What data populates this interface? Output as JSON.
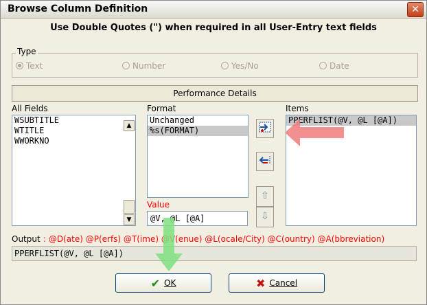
{
  "window": {
    "title": "Browse Column Definition",
    "close": "✕"
  },
  "banner": "Use Double Quotes (\") when required in all User-Entry text fields",
  "type_group": {
    "label": "Type",
    "options": [
      "Text",
      "Number",
      "Yes/No",
      "Date"
    ],
    "selected": "Text"
  },
  "perf_bar": "Performance Details",
  "all_fields": {
    "label": "All Fields",
    "items": [
      "WSUBTITLE",
      "WTITLE",
      "WWORKNO"
    ]
  },
  "format": {
    "label": "Format",
    "items": [
      "Unchanged",
      "%s(FORMAT)"
    ],
    "selected_index": 1
  },
  "items_list": {
    "label": "Items",
    "items": [
      "PPERFLIST(@V, @L [@A])"
    ],
    "selected_index": 0
  },
  "value": {
    "label": "Value",
    "text": "@V, @L [@A]"
  },
  "output": {
    "label": "Output",
    "legend": ": @D(ate) @P(erfs) @T(ime) @V(enue) @L(ocale/City) @C(ountry) @A(bbreviation)",
    "text": "PPERFLIST(@V, @L [@A])"
  },
  "buttons": {
    "ok": "OK",
    "cancel": "Cancel"
  },
  "colors": {
    "red_text": "#ff0000",
    "annotation_red": "#f07b7b",
    "annotation_green": "#7fe07f"
  }
}
